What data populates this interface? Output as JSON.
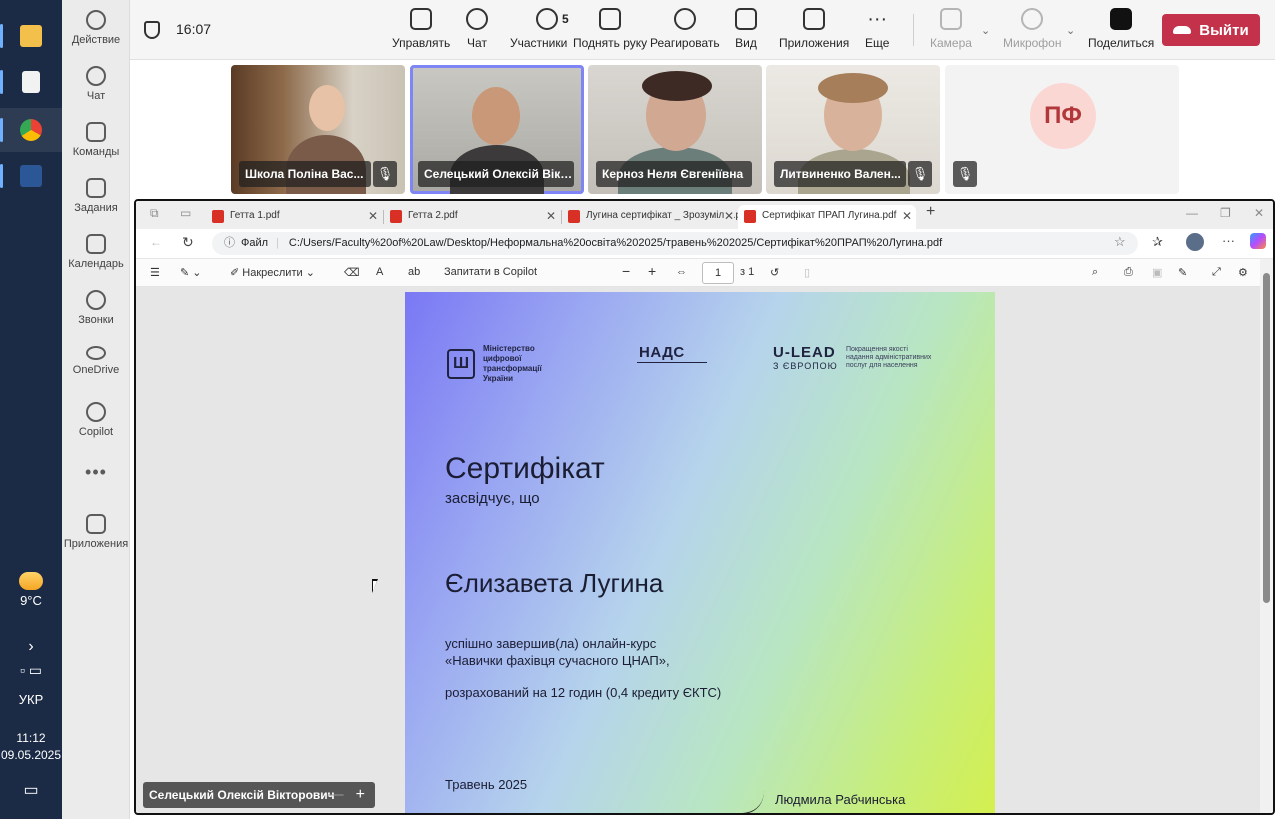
{
  "taskbar": {
    "weather": {
      "temp": "9°C"
    },
    "language": "УКР",
    "time": "11:12",
    "date": "09.05.2025"
  },
  "rail": {
    "items": [
      {
        "label": "Действие",
        "icon": "bell-icon"
      },
      {
        "label": "Чат",
        "icon": "chat-icon"
      },
      {
        "label": "Команды",
        "icon": "teams-icon"
      },
      {
        "label": "Задания",
        "icon": "assignments-icon"
      },
      {
        "label": "Календарь",
        "icon": "calendar-icon"
      },
      {
        "label": "Звонки",
        "icon": "phone-icon"
      },
      {
        "label": "OneDrive",
        "icon": "cloud-icon"
      },
      {
        "label": "Copilot",
        "icon": "copilot-icon"
      },
      {
        "label": "Приложения",
        "icon": "plus-icon"
      }
    ]
  },
  "meeting": {
    "timer": "16:07",
    "toolbar": {
      "manage": "Управлять",
      "chat": "Чат",
      "participants": "Участники",
      "participants_count": "5",
      "raise_hand": "Поднять руку",
      "react": "Реагировать",
      "view": "Вид",
      "apps": "Приложения",
      "more": "Еще",
      "camera": "Камера",
      "mic": "Микрофон",
      "share": "Поделиться",
      "leave": "Выйти"
    },
    "participants": [
      {
        "name": "Школа Поліна Вас..."
      },
      {
        "name": "Селецький Олексій Вікт..."
      },
      {
        "name": "Керноз Неля Євгеніївна"
      },
      {
        "name": "Литвиненко Вален..."
      },
      {
        "initials": "ПФ"
      }
    ],
    "presenter_label": "Селецький Олексій Вікторович",
    "presenter_controls": {
      "minus": "—",
      "plus": "+"
    }
  },
  "browser": {
    "tabs": [
      {
        "label": "Гетта 1.pdf"
      },
      {
        "label": "Гетта 2.pdf"
      },
      {
        "label": "Лугина сертифікат _ Зрозуміло!.p"
      },
      {
        "label": "Сертифікат ПРАП Лугина.pdf"
      }
    ],
    "new_tab": "+",
    "address": {
      "scheme_label": "Файл",
      "url": "C:/Users/Faculty%20of%20Law/Desktop/Неформальна%20освіта%202025/травень%202025/Сертифікат%20ПРАП%20Лугина.pdf"
    },
    "pdf_toolbar": {
      "draw": "Накреслити",
      "copilot": "Запитати в Copilot",
      "page_current": "1",
      "page_total": "з 1",
      "zoom_out": "−",
      "zoom_in": "+"
    }
  },
  "certificate": {
    "logo1": "Міністерство цифрової трансформації України",
    "logo2": "НАДС",
    "logo3": "U-LEAD",
    "logo3_sub": "З ЄВРОПОЮ",
    "logo3_text": "Покращення якості надання адміністративних послуг для населення",
    "title": "Сертифікат",
    "subtitle": "засвідчує, що",
    "person": "Єлизавета Лугина",
    "line1": "успішно завершив(ла) онлайн-курс",
    "line2": "«Навички фахівця сучасного ЦНАП»,",
    "line3": "розрахований на 12 годин (0,4 кредиту ЄКТС)",
    "date": "Травень 2025",
    "signer": "Людмила Рабчинська"
  }
}
